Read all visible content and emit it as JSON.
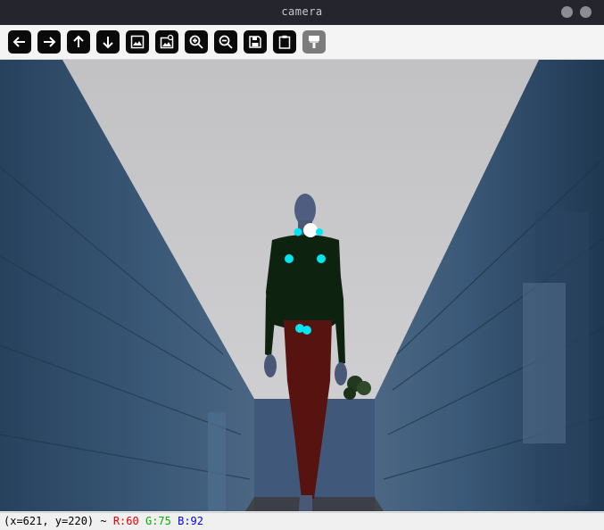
{
  "window": {
    "title": "camera"
  },
  "toolbar": {
    "buttons": [
      {
        "name": "pan-left",
        "icon": "arrow-left-icon"
      },
      {
        "name": "pan-right",
        "icon": "arrow-right-icon"
      },
      {
        "name": "pan-up",
        "icon": "arrow-up-icon"
      },
      {
        "name": "pan-down",
        "icon": "arrow-down-icon"
      },
      {
        "name": "zoom-image",
        "icon": "image-icon"
      },
      {
        "name": "zoom-image-detail",
        "icon": "image-search-icon"
      },
      {
        "name": "zoom-in",
        "icon": "zoom-in-icon"
      },
      {
        "name": "zoom-out",
        "icon": "zoom-out-icon"
      },
      {
        "name": "save",
        "icon": "save-icon"
      },
      {
        "name": "copy-clipboard",
        "icon": "clipboard-icon"
      },
      {
        "name": "properties",
        "icon": "paint-brush-icon",
        "disabled": true
      }
    ]
  },
  "status": {
    "coords": "(x=621, y=220) ~ ",
    "r": "R:60",
    "g": "G:75",
    "b": "B:92",
    "colors": {
      "r": "#e00000",
      "g": "#00b000",
      "b": "#0000e0"
    }
  },
  "scene": {
    "description_colors": {
      "sky": "#c7c7c9",
      "wall": "#2f4a66",
      "torso": "#0f2412",
      "legs": "#5a1410",
      "skin": "#5a6b8c",
      "keypoint": "#00e5f0"
    }
  }
}
